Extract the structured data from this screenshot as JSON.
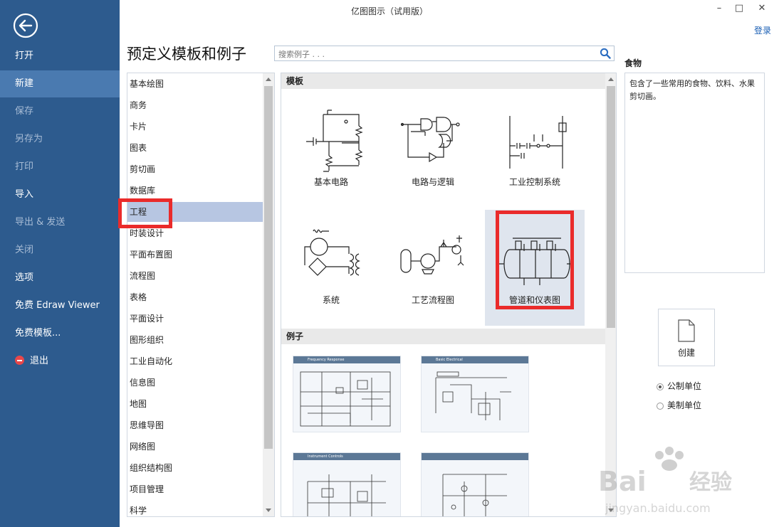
{
  "window": {
    "title": "亿图图示（试用版）",
    "login": "登录"
  },
  "sidebar": {
    "items": [
      {
        "label": "打开"
      },
      {
        "label": "新建"
      },
      {
        "label": "保存"
      },
      {
        "label": "另存为"
      },
      {
        "label": "打印"
      },
      {
        "label": "导入"
      },
      {
        "label": "导出 & 发送"
      },
      {
        "label": "关闭"
      },
      {
        "label": "选项"
      },
      {
        "label": "免费 Edraw Viewer"
      },
      {
        "label": "免费模板..."
      },
      {
        "label": "退出"
      }
    ],
    "active_index": 1
  },
  "main": {
    "heading": "预定义模板和例子",
    "search_placeholder": "搜索例子 . . ."
  },
  "categories": [
    "基本绘图",
    "商务",
    "卡片",
    "图表",
    "剪切画",
    "数据库",
    "工程",
    "时装设计",
    "平面布置图",
    "流程图",
    "表格",
    "平面设计",
    "图形组织",
    "工业自动化",
    "信息图",
    "地图",
    "思维导图",
    "网络图",
    "组织结构图",
    "项目管理",
    "科学"
  ],
  "selected_category": "工程",
  "templates": {
    "section_title": "模板",
    "items": [
      {
        "label": "基本电路"
      },
      {
        "label": "电路与逻辑"
      },
      {
        "label": "工业控制系统"
      },
      {
        "label": "系统"
      },
      {
        "label": "工艺流程图"
      },
      {
        "label": "管道和仪表图"
      }
    ],
    "selected": "管道和仪表图"
  },
  "examples": {
    "section_title": "例子",
    "items": [
      {
        "header": "Frequency Response"
      },
      {
        "header": "Basic Electrical"
      },
      {
        "header": "Instrument Controls"
      },
      {
        "header": ""
      }
    ]
  },
  "details": {
    "title": "食物",
    "description": "包含了一些常用的食物、饮料、水果剪切画。",
    "create_label": "创建",
    "units": [
      {
        "label": "公制单位",
        "checked": true
      },
      {
        "label": "美制单位",
        "checked": false
      }
    ]
  },
  "watermark": {
    "brand": "Baidu经验",
    "url": "jingyan.baidu.com"
  },
  "colors": {
    "sidebar": "#2d5b8e",
    "sidebar_active": "#4a7ab0",
    "highlight": "#ea2b2b",
    "selection": "#b7c6e2"
  }
}
